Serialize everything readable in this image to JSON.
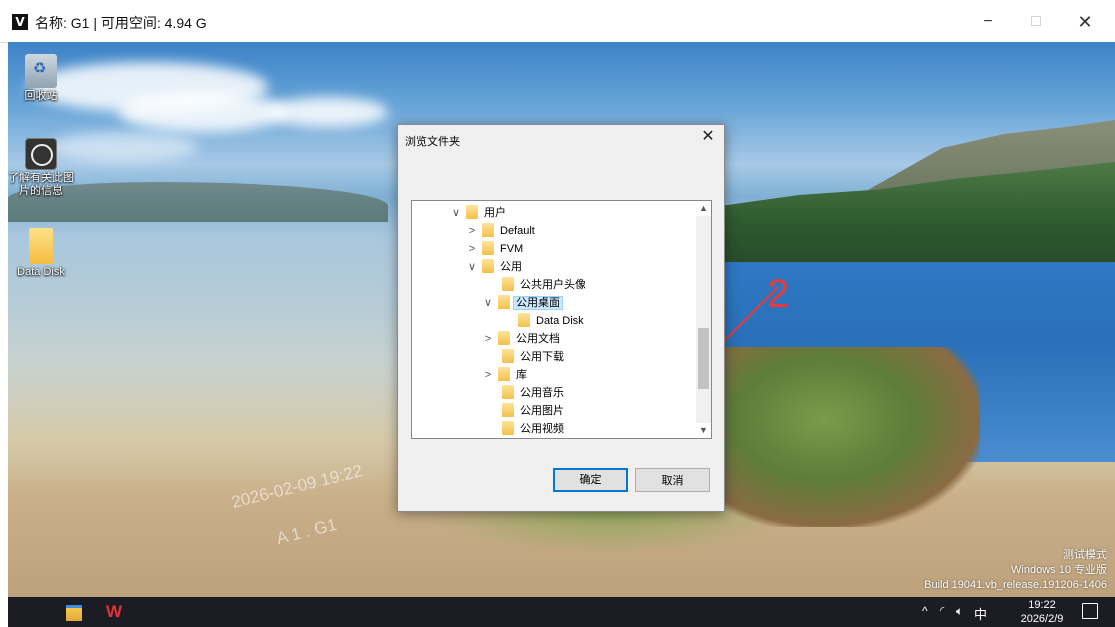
{
  "window": {
    "logo_letter": "V",
    "title": "名称: G1 | 可用空间: 4.94 G",
    "minimize": "−",
    "maximize": "□",
    "close": "✕"
  },
  "desktop": {
    "icons": [
      {
        "label": "回收站",
        "icon": "recycle-bin-icon"
      },
      {
        "label": "了解有关此图片的信息",
        "icon": "camera-lens-icon"
      },
      {
        "label": "Data Disk",
        "icon": "folder-icon"
      }
    ],
    "watermark_time": "2026-02-09 19:22",
    "watermark_user": "A   1 . G1",
    "windows_mark": [
      "测试模式",
      "Windows 10 专业版",
      "Build 19041.vb_release.191206-1406"
    ]
  },
  "dialog": {
    "title": "浏览文件夹",
    "close": "✕",
    "tree": [
      {
        "label": "用户",
        "chevron": "∨",
        "selected": false
      },
      {
        "label": "Default",
        "chevron": ">",
        "selected": false
      },
      {
        "label": "FVM",
        "chevron": ">",
        "selected": false
      },
      {
        "label": "公用",
        "chevron": "∨",
        "selected": false
      },
      {
        "label": "公共用户头像",
        "chevron": "",
        "selected": false
      },
      {
        "label": "公用桌面",
        "chevron": "∨",
        "selected": true
      },
      {
        "label": "Data Disk",
        "chevron": "",
        "selected": false
      },
      {
        "label": "公用文档",
        "chevron": ">",
        "selected": false
      },
      {
        "label": "公用下载",
        "chevron": "",
        "selected": false
      },
      {
        "label": "库",
        "chevron": ">",
        "selected": false
      },
      {
        "label": "公用音乐",
        "chevron": "",
        "selected": false
      },
      {
        "label": "公用图片",
        "chevron": "",
        "selected": false
      },
      {
        "label": "公用视频",
        "chevron": "",
        "selected": false
      }
    ],
    "ok_label": "确定",
    "cancel_label": "取消"
  },
  "annotation": {
    "number": "2",
    "color": "#e83a3a"
  },
  "taskbar": {
    "tray_icons": [
      "^",
      "wifi-icon",
      "volume-icon"
    ],
    "ime": "中",
    "time": "19:22",
    "date": "2026/2/9"
  }
}
